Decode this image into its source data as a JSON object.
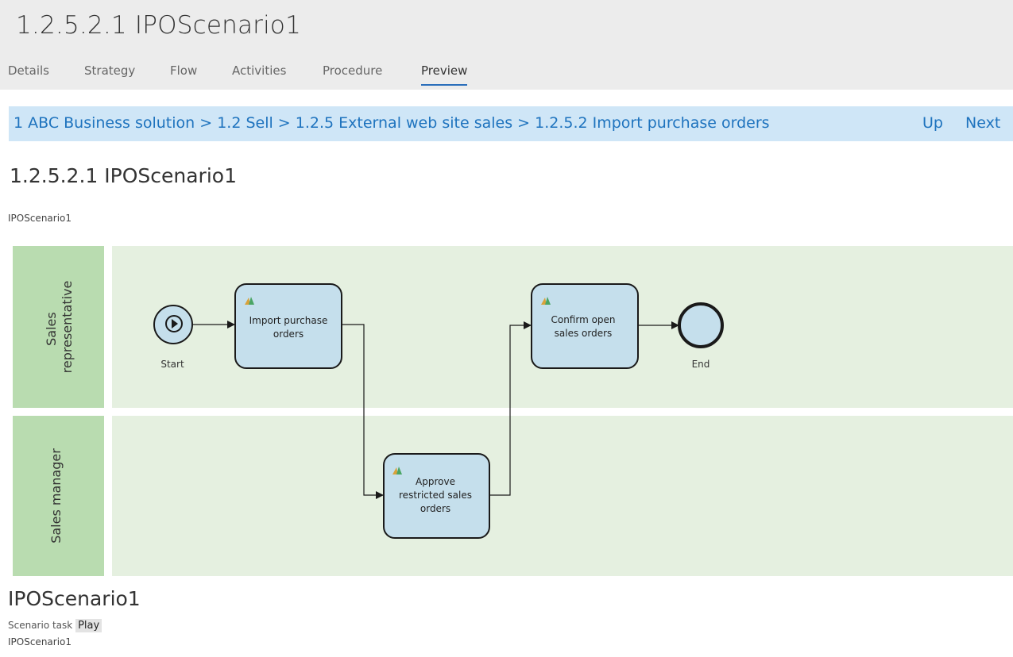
{
  "window": {
    "title": "1.2.5.2.1 IPOScenario1"
  },
  "tabs": [
    {
      "label": "Details"
    },
    {
      "label": "Strategy"
    },
    {
      "label": "Flow"
    },
    {
      "label": "Activities"
    },
    {
      "label": "Procedure"
    },
    {
      "label": "Preview"
    }
  ],
  "active_tab": "Preview",
  "breadcrumb": {
    "text": "1 ABC Business solution > 1.2 Sell > 1.2.5 External web site sales > 1.2.5.2 Import purchase orders"
  },
  "nav": {
    "up": "Up",
    "next": "Next"
  },
  "section": {
    "heading": "1.2.5.2.1 IPOScenario1",
    "description": "IPOScenario1"
  },
  "diagram": {
    "lanes": [
      {
        "line1": "Sales",
        "line2": "representative"
      },
      {
        "line1": "Sales manager"
      }
    ],
    "start_label": "Start",
    "end_label": "End",
    "tasks": [
      {
        "line1": "Import purchase",
        "line2": "orders"
      },
      {
        "line1": "Approve",
        "line2": "restricted sales",
        "line3": "orders"
      },
      {
        "line1": "Confirm open",
        "line2": "sales orders"
      }
    ],
    "colors": {
      "lane_header": "#b9dcb0",
      "lane_body": "#e5f0e0",
      "task_fill": "#c5dfec",
      "stroke": "#1a1a1a"
    }
  },
  "footer": {
    "title": "IPOScenario1",
    "task_label": "Scenario task",
    "play_label": "Play",
    "scenario_id": "IPOScenario1"
  }
}
